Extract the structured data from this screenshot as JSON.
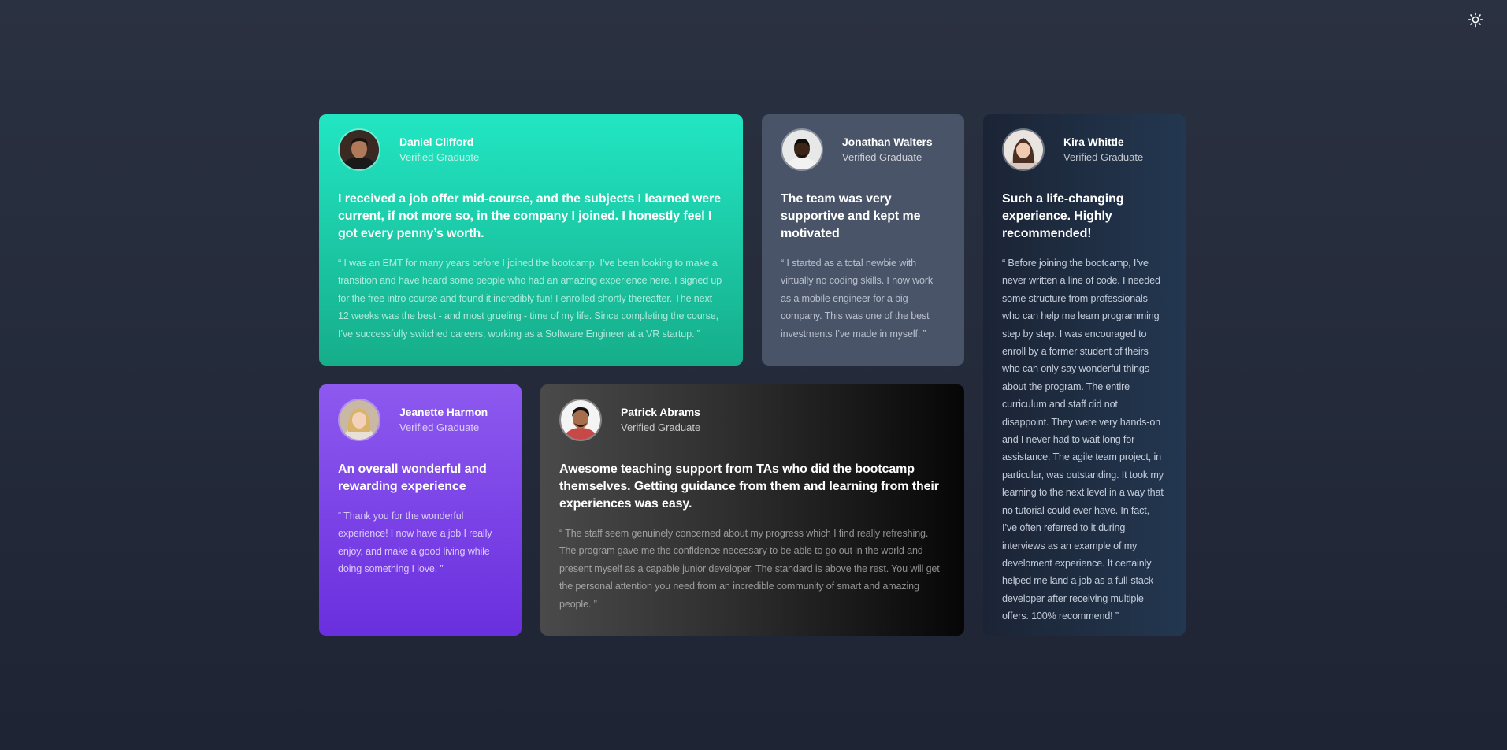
{
  "theme_toggle": {
    "icon": "sun-icon"
  },
  "testimonials": [
    {
      "name": "Daniel Clifford",
      "role": "Verified Graduate",
      "headline": "I received a job offer mid-course, and the subjects I learned were current, if not more so, in the company I joined. I honestly feel I got every penny’s worth.",
      "quote": "“ I was an EMT for many years before I joined the bootcamp. I’ve been looking to make a transition and have heard some people who had an amazing experience here. I signed up for the free intro course and found it incredibly fun! I enrolled shortly thereafter. The next 12 weeks was the best - and most grueling - time of my life. Since completing the course, I’ve successfully switched careers, working as a Software Engineer at a VR startup. ”",
      "color": "#22e6c3"
    },
    {
      "name": "Jonathan Walters",
      "role": "Verified Graduate",
      "headline": "The team was very supportive and kept me motivated",
      "quote": "“ I started as a total newbie with virtually no coding skills. I now work as a mobile engineer for a big company. This was one of the best investments I’ve made in myself. ”",
      "color": "#4a5468"
    },
    {
      "name": "Kira Whittle",
      "role": "Verified Graduate",
      "headline": "Such a life-changing experience. Highly recommended!",
      "quote": "“ Before joining the bootcamp, I’ve never written a line of code. I needed some structure from professionals who can help me learn programming step by step. I was encouraged to enroll by a former student of theirs who can only say wonderful things about the program. The entire curriculum and staff did not disappoint. They were very hands-on and I never had to wait long for assistance. The agile team project, in particular, was outstanding. It took my learning to the next level in a way that no tutorial could ever have. In fact, I’ve often referred to it during interviews as an example of my develoment experience. It certainly helped me land a job as a full-stack developer after receiving multiple offers. 100% recommend! ”",
      "color": "#1b2435"
    },
    {
      "name": "Jeanette Harmon",
      "role": "Verified Graduate",
      "headline": "An overall wonderful and rewarding experience",
      "quote": "“ Thank you for the wonderful experience! I now have a job I really enjoy, and make a good living while doing something I love. ”",
      "color": "#7b45e8"
    },
    {
      "name": "Patrick Abrams",
      "role": "Verified Graduate",
      "headline": "Awesome teaching support from TAs who did the bootcamp themselves. Getting guidance from them and learning from their experiences was easy.",
      "quote": "“ The staff seem genuinely concerned about my progress which I find really refreshing. The program gave me the confidence necessary to be able to go out in the world and present myself as a capable junior developer. The standard is above the rest. You will get the personal attention you need from an incredible community of smart and amazing people. ”",
      "color": "#2e2e2e"
    }
  ]
}
